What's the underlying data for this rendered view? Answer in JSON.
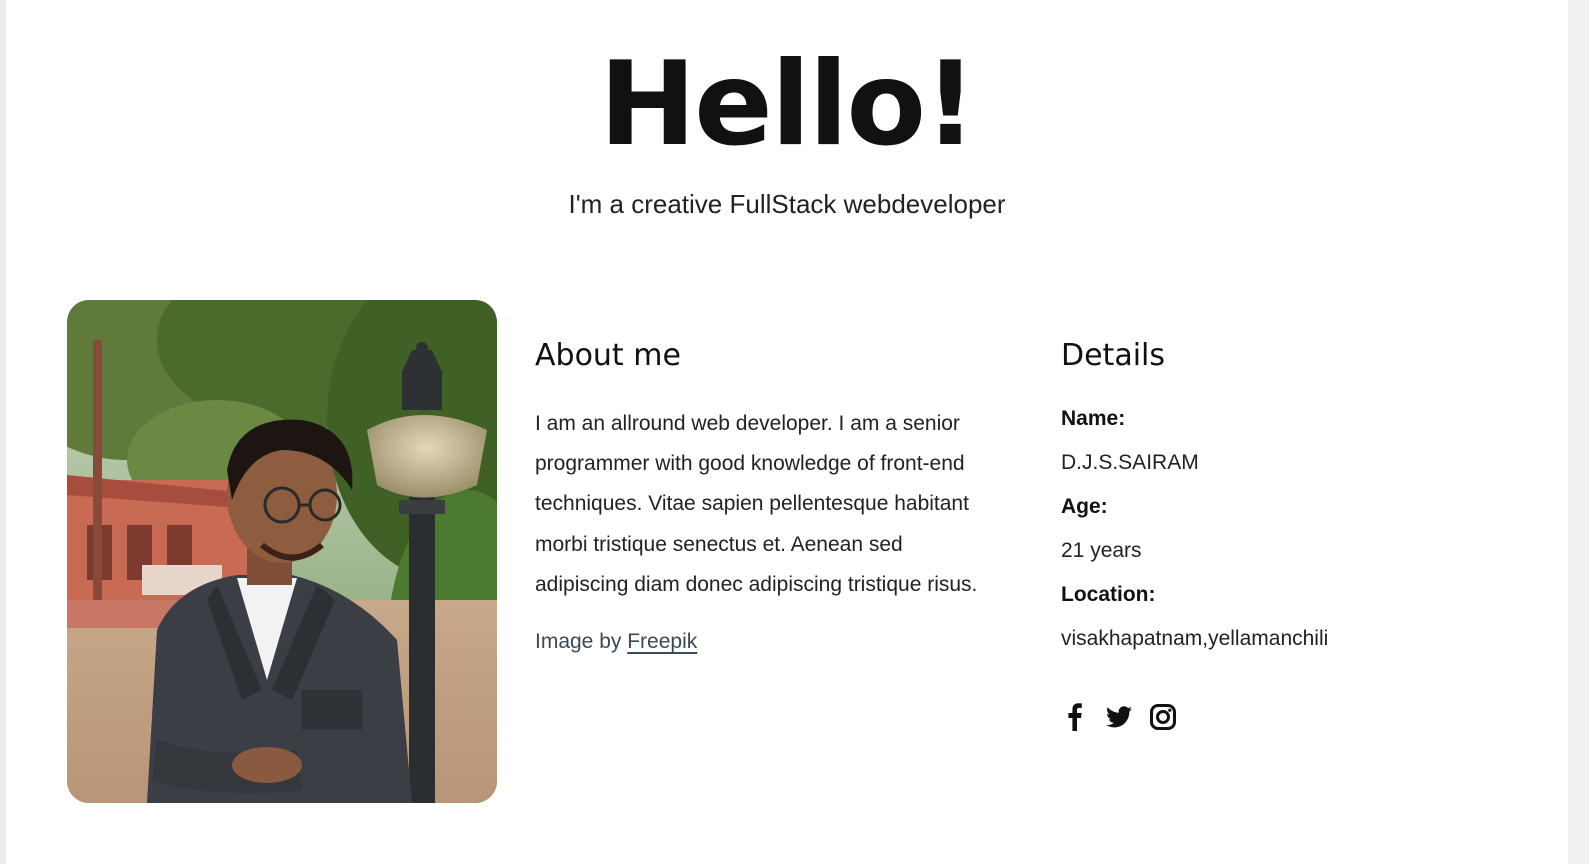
{
  "hero": {
    "title": "Hello!",
    "subtitle": "I'm a creative FullStack webdeveloper"
  },
  "about": {
    "heading": "About me",
    "text": "I am an allround web developer. I am a senior programmer with good knowledge of front-end techniques. Vitae sapien pellentesque habitant morbi tristique senectus et. Aenean sed adipiscing diam donec adipiscing tristique risus.",
    "credit_prefix": "Image by ",
    "credit_link": "Freepik"
  },
  "details": {
    "heading": "Details",
    "name_label": "Name:",
    "name_value": "D.J.S.SAIRAM",
    "age_label": "Age:",
    "age_value": "21 years",
    "location_label": "Location:",
    "location_value": "visakhapatnam,yellamanchili"
  },
  "socials": [
    {
      "icon": "facebook-icon"
    },
    {
      "icon": "twitter-icon"
    },
    {
      "icon": "instagram-icon"
    }
  ],
  "colors": {
    "text": "#111111",
    "link": "#3a4a55",
    "background": "#ffffff"
  }
}
